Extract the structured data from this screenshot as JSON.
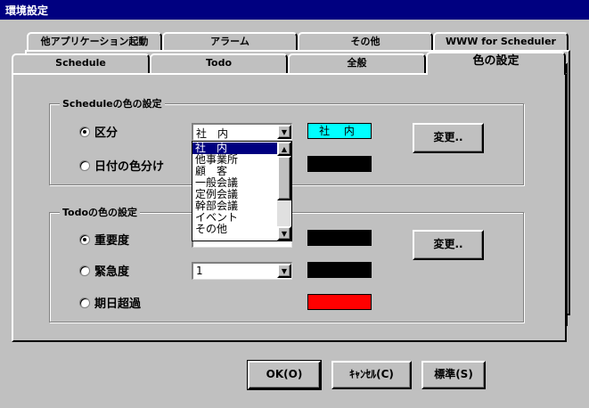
{
  "window": {
    "title": "環境設定"
  },
  "tabs_back_row": [
    {
      "label": "他アプリケーション起動"
    },
    {
      "label": "アラーム"
    },
    {
      "label": "その他"
    },
    {
      "label": "WWW for Scheduler"
    }
  ],
  "tabs_front_row": [
    {
      "label": "Schedule"
    },
    {
      "label": "Todo"
    },
    {
      "label": "全般"
    },
    {
      "label": "色の設定",
      "active": true
    }
  ],
  "schedule_group": {
    "title": "Scheduleの色の設定",
    "radio_category": {
      "label": "区分",
      "checked": true
    },
    "radio_date": {
      "label": "日付の色分け",
      "checked": false
    },
    "category_combo": {
      "value": "社　内"
    },
    "category_swatch": {
      "text": "社 内",
      "color": "#00ffff"
    },
    "date_swatch": {
      "color": "#000000"
    },
    "change_button": "変更.."
  },
  "category_dropdown": {
    "items": [
      "社　内",
      "他事業所",
      "顧　客",
      "一般会議",
      "定例会議",
      "幹部会議",
      "イベント",
      "その他"
    ],
    "selected_index": 0
  },
  "todo_group": {
    "title": "Todoの色の設定",
    "radio_importance": {
      "label": "重要度",
      "checked": true
    },
    "radio_urgency": {
      "label": "緊急度",
      "checked": false
    },
    "radio_overdue": {
      "label": "期日超過",
      "checked": false
    },
    "urgency_combo": {
      "value": "1"
    },
    "importance_swatch": {
      "color": "#000000"
    },
    "urgency_swatch": {
      "color": "#000000"
    },
    "overdue_swatch": {
      "color": "#ff0000"
    },
    "change_button": "変更.."
  },
  "footer": {
    "ok": "OK(O)",
    "cancel": "ｷｬﾝｾﾙ(C)",
    "standard": "標準(S)"
  },
  "icons": {
    "combo_arrow": "chevron-down-icon",
    "scroll_up": "chevron-up-icon",
    "scroll_down": "chevron-down-icon"
  }
}
